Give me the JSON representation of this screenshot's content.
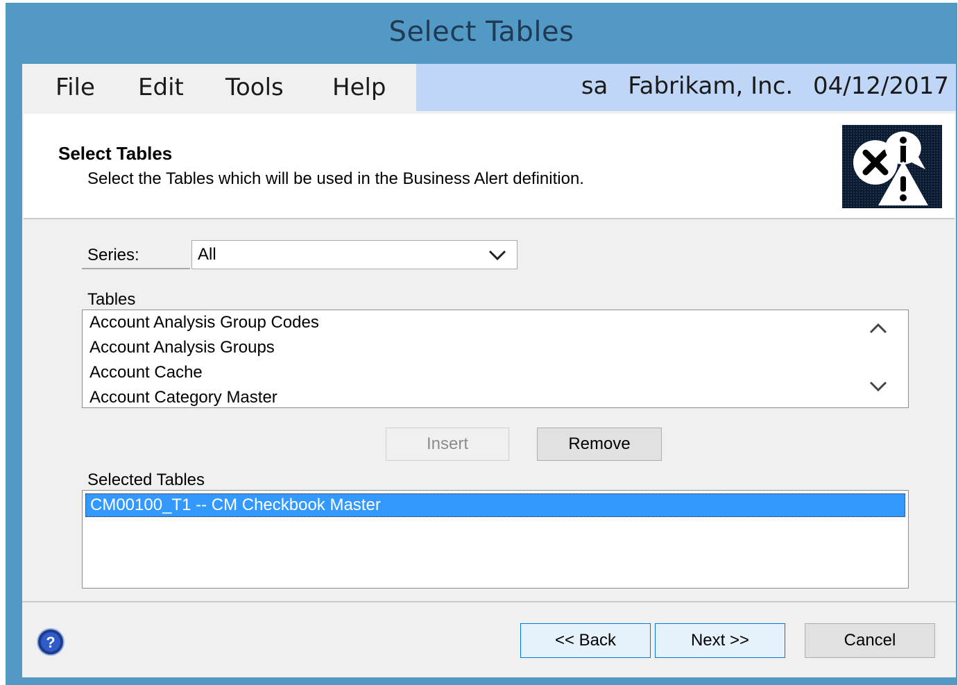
{
  "window": {
    "title": "Select Tables"
  },
  "menubar": {
    "menus": [
      "File",
      "Edit",
      "Tools",
      "Help"
    ],
    "user": "sa",
    "company": "Fabrikam, Inc.",
    "date": "04/12/2017"
  },
  "header": {
    "title": "Select Tables",
    "subtitle": "Select the Tables which will be used in the Business Alert definition.",
    "icon": "business-alert-icon"
  },
  "series": {
    "label": "Series:",
    "value": "All"
  },
  "tables": {
    "label": "Tables",
    "items": [
      "Account Analysis Group Codes",
      "Account Analysis Groups",
      "Account Cache",
      "Account Category Master"
    ]
  },
  "buttons": {
    "insert": "Insert",
    "remove": "Remove",
    "back": "<< Back",
    "next": "Next >>",
    "cancel": "Cancel"
  },
  "selected_tables": {
    "label": "Selected Tables",
    "items": [
      "CM00100_T1 -- CM Checkbook Master"
    ]
  },
  "colors": {
    "titlebar": "#5399c6",
    "selection": "#3399ff",
    "userbar": "#bfd6f6"
  }
}
